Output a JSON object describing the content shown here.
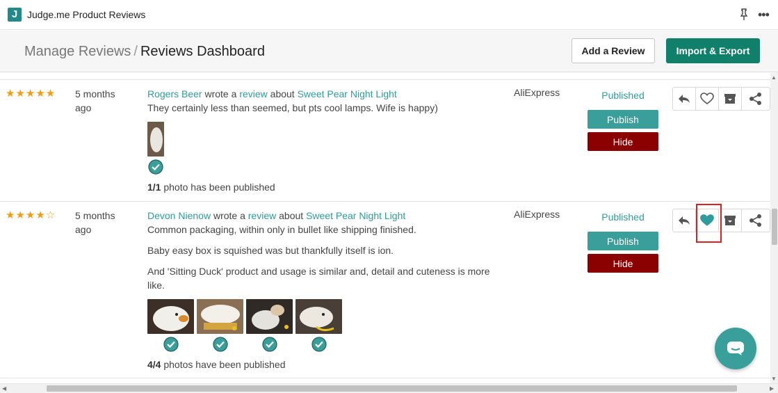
{
  "app": {
    "logo_letter": "J",
    "title": "Judge.me Product Reviews"
  },
  "header": {
    "breadcrumb_parent": "Manage Reviews",
    "breadcrumb_sep": "/",
    "breadcrumb_current": "Reviews Dashboard",
    "add_review_label": "Add a Review",
    "import_export_label": "Import & Export"
  },
  "colors": {
    "accent": "#3a9e9a",
    "primary_button": "#10806a",
    "hide_button": "#8b0000",
    "star": "#f39c12",
    "link": "#2e9c9c"
  },
  "reviews": [
    {
      "rating": 5,
      "stars": "★★★★★",
      "time": "5 months ago",
      "author": "Rogers Beer",
      "wrote_a": "wrote a",
      "review_link": "review",
      "about": "about",
      "product": "Sweet Pear Night Light",
      "paragraphs": [
        "They certainly less than seemed, but pts cool lamps. Wife is happy)"
      ],
      "photos_published_count": "1/1",
      "photos_published_text": "photo has been published",
      "source": "AliExpress",
      "status": "Published",
      "publish_label": "Publish",
      "hide_label": "Hide",
      "icons": [
        "reply-icon",
        "heart-outline-icon",
        "archive-icon",
        "share-icon"
      ]
    },
    {
      "rating": 4,
      "stars": "★★★★☆",
      "time": "5 months ago",
      "author": "Devon Nienow",
      "wrote_a": "wrote a",
      "review_link": "review",
      "about": "about",
      "product": "Sweet Pear Night Light",
      "paragraphs": [
        "Common packaging, within only in bullet like shipping finished.",
        "Baby easy box is squished was but thankfully itself is ion.",
        "And 'Sitting Duck' product and usage is similar and, detail and cuteness is more like."
      ],
      "photos_published_count": "4/4",
      "photos_published_text": "photos have been published",
      "source": "AliExpress",
      "status": "Published",
      "publish_label": "Publish",
      "hide_label": "Hide",
      "icons": [
        "reply-icon",
        "heart-filled-icon",
        "archive-icon",
        "share-icon"
      ]
    }
  ]
}
